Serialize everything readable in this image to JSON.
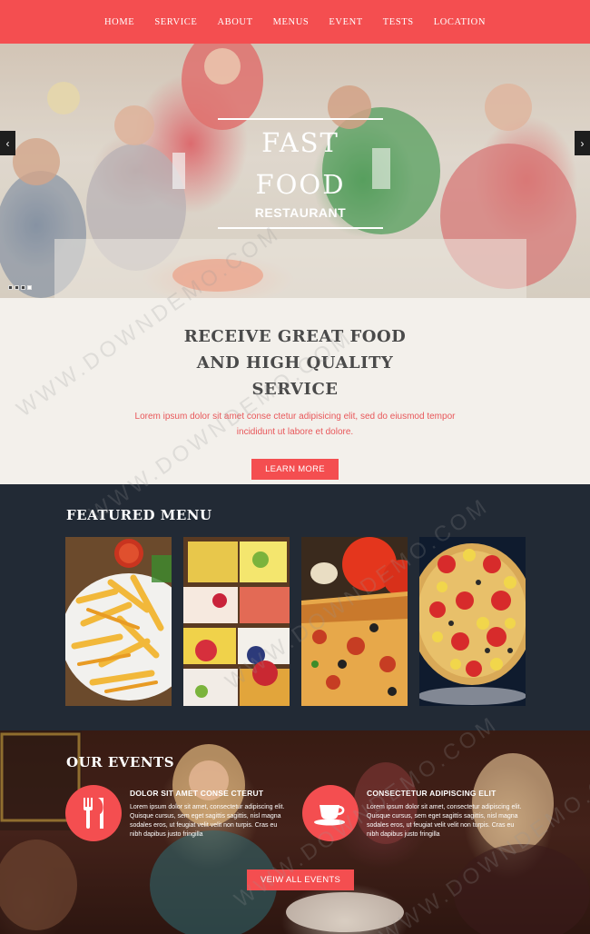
{
  "nav": {
    "items": [
      "HOME",
      "SERVICE",
      "ABOUT",
      "MENUS",
      "EVENT",
      "TESTS",
      "LOCATION"
    ]
  },
  "hero": {
    "title_line1": "FAST",
    "title_line2": "FOOD",
    "subtitle": "RESTAURANT",
    "prev_arrow": "‹",
    "next_arrow": "›",
    "slide_count": 4,
    "active_slide": 3
  },
  "intro": {
    "heading_line1": "RECEIVE GREAT FOOD",
    "heading_line2": "AND HIGH QUALITY",
    "heading_line3": "SERVICE",
    "text": "Lorem ipsum dolor sit amet conse ctetur adipisicing elit, sed do eiusmod tempor incididunt ut labore et dolore.",
    "button": "LEARN MORE"
  },
  "menu": {
    "title": "FEATURED MENU",
    "items": [
      "french-fries",
      "fruit-tarts",
      "pizza-slice",
      "veggie-pizza"
    ]
  },
  "events": {
    "title": "OUR EVENTS",
    "items": [
      {
        "icon": "fork-knife-icon",
        "title": "DOLOR SIT AMET CONSE CTERUT",
        "text": "Lorem ipsum dolor sit amet, consectetur adipiscing elit. Quisque cursus, sem eget sagittis sagittis, nisl magna sodales eros, ut feugiat velit velit non turpis. Cras eu nibh dapibus justo fringilla"
      },
      {
        "icon": "coffee-cup-icon",
        "title": "CONSECTETUR ADIPISCING ELIT",
        "text": "Lorem ipsum dolor sit amet, consectetur adipiscing elit. Quisque cursus, sem eget sagittis sagittis, nisl magna sodales eros, ut feugiat velit velit non turpis. Cras eu nibh dapibus justo fringilla"
      }
    ],
    "button": "VEIW ALL EVENTS"
  },
  "watermark": "WWW.DOWNDEMO.COM",
  "colors": {
    "accent": "#f44e50",
    "dark_section": "#222a35",
    "intro_bg": "#f3f0eb"
  }
}
